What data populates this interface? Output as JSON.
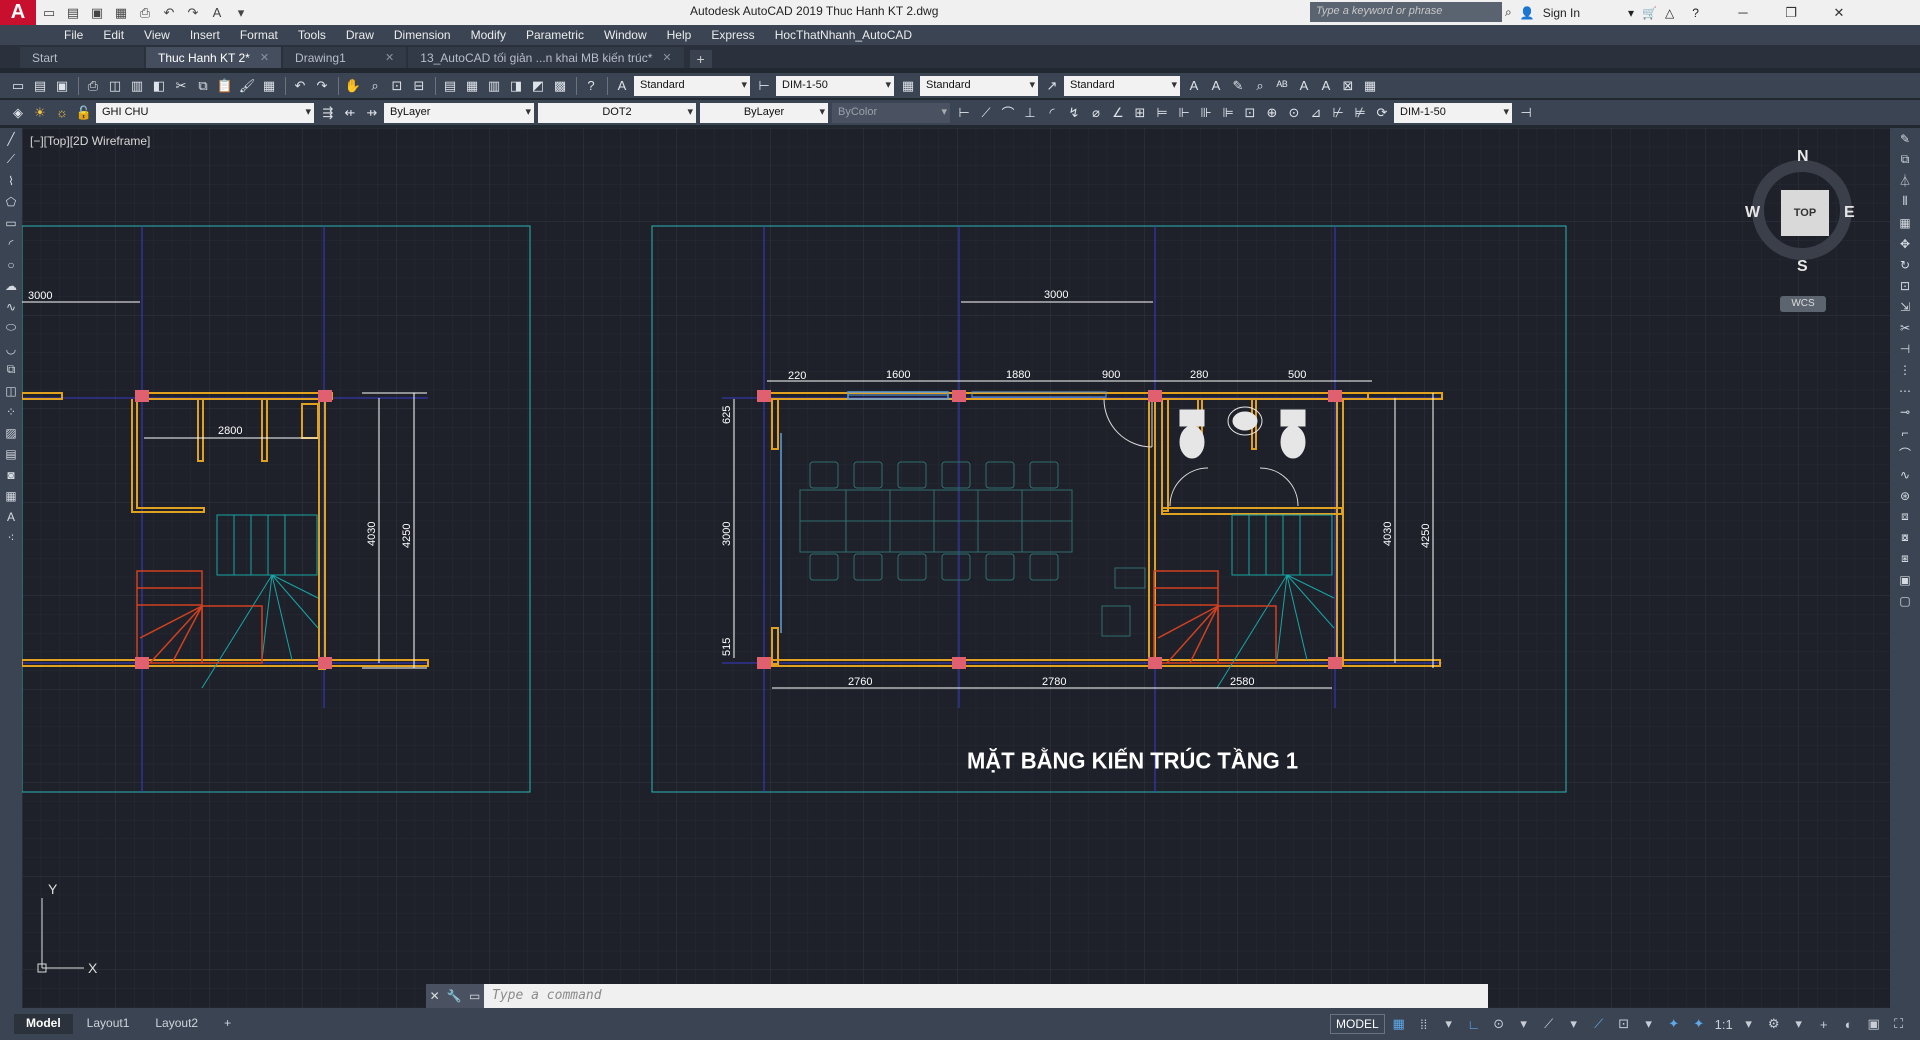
{
  "app": {
    "logo": "A",
    "title": "Autodesk AutoCAD 2019    Thuc Hanh KT 2.dwg",
    "search_placeholder": "Type a keyword or phrase",
    "sign_in": "Sign In"
  },
  "menu": [
    "File",
    "Edit",
    "View",
    "Insert",
    "Format",
    "Tools",
    "Draw",
    "Dimension",
    "Modify",
    "Parametric",
    "Window",
    "Help",
    "Express",
    "HocThatNhanh_AutoCAD"
  ],
  "tabs": [
    {
      "label": "Start",
      "closable": false
    },
    {
      "label": "Thuc Hanh KT 2*",
      "closable": true,
      "active": true
    },
    {
      "label": "Drawing1",
      "closable": true
    },
    {
      "label": "13_AutoCAD tối giản ...n khai MB kiến trúc*",
      "closable": true
    }
  ],
  "toolbar1": {
    "text_style": "Standard",
    "dim_style": "DIM-1-50",
    "table_style": "Standard",
    "multileader_style": "Standard"
  },
  "toolbar2": {
    "layer": "GHI CHU",
    "color": "ByLayer",
    "linetype": "DOT2",
    "lineweight": "ByLayer",
    "plotstyle": "ByColor",
    "dim_style": "DIM-1-50"
  },
  "viewport": {
    "label": "[−][Top][2D Wireframe]"
  },
  "viewcube": {
    "north": "N",
    "south": "S",
    "east": "E",
    "west": "W",
    "face": "TOP",
    "wcs": "WCS"
  },
  "ucs": {
    "x": "X",
    "y": "Y"
  },
  "drawing": {
    "title": "MẶT BẰNG KIẾN TRÚC TẦNG 1",
    "left_dims": {
      "top": "3000",
      "inner": "2800",
      "v1": "4030",
      "v2": "4250"
    },
    "right_dims": {
      "top_overall": "3000",
      "d220": "220",
      "d1600": "1600",
      "d1880": "1880",
      "d900": "900",
      "d280": "280",
      "d500": "500",
      "v625": "625",
      "v3000": "3000",
      "v515": "515",
      "v4030": "4030",
      "v4250": "4250",
      "b2760": "2760",
      "b2780": "2780",
      "b2580": "2580"
    }
  },
  "command": {
    "placeholder": "Type a command"
  },
  "layouts": [
    {
      "label": "Model",
      "active": true
    },
    {
      "label": "Layout1"
    },
    {
      "label": "Layout2"
    }
  ],
  "status": {
    "model": "MODEL",
    "scale": "1:1"
  }
}
